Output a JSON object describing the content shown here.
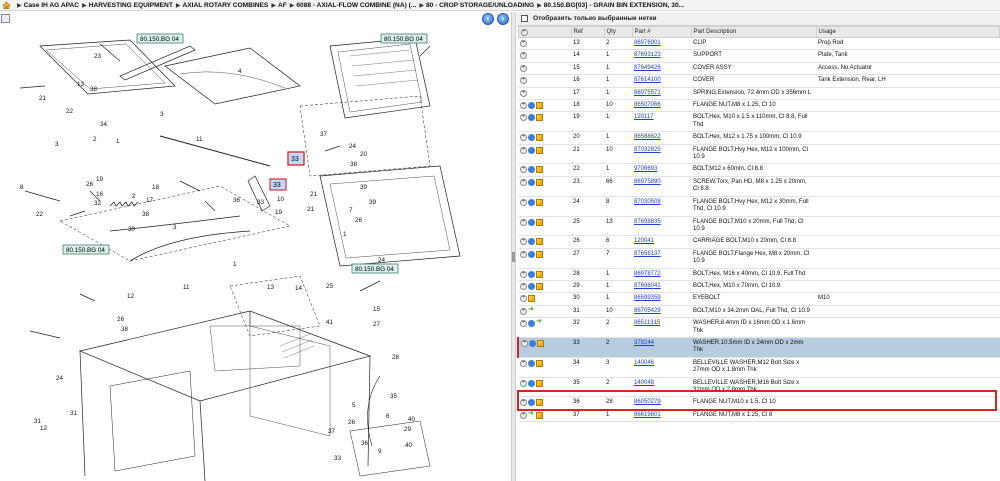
{
  "breadcrumb": {
    "items": [
      "Case IH AG APAC",
      "HARVESTING EQUIPMENT",
      "AXIAL ROTARY COMBINES",
      "AF",
      "6088 - AXIAL-FLOW COMBINE (NA) (...",
      "80 - CROP STORAGE/UNLOADING",
      "80.150.BG[03] - GRAIN BIN EXTENSION, 30..."
    ]
  },
  "filter": {
    "label": "Отобразить только выбранные нетки"
  },
  "diagram": {
    "ref_tags": [
      "80.150.BG 04",
      "80.150.BG 04",
      "80.150.BG 04",
      "80.150.BG 04"
    ],
    "highlighted_callouts": [
      "33",
      "33"
    ],
    "callouts": [
      "23",
      "13",
      "38",
      "4",
      "21",
      "22",
      "1",
      "3",
      "34",
      "2",
      "3",
      "11",
      "37",
      "24",
      "20",
      "38",
      "19",
      "26",
      "16",
      "18",
      "39",
      "2",
      "17",
      "36",
      "38",
      "30",
      "3",
      "32",
      "22",
      "8",
      "19",
      "21",
      "39",
      "1",
      "26",
      "7",
      "10",
      "33",
      "21",
      "24",
      "1",
      "11",
      "12",
      "13",
      "14",
      "31",
      "12",
      "5",
      "25",
      "26",
      "38",
      "41",
      "28",
      "15",
      "27",
      "35",
      "6",
      "40",
      "29",
      "26",
      "9",
      "36",
      "37",
      "33",
      "40",
      "31",
      "24"
    ]
  },
  "table": {
    "columns": [
      "",
      "Ref",
      "Qty",
      "Part #",
      "Part Description",
      "Usage"
    ],
    "rows": [
      {
        "icons": [
          "plus"
        ],
        "ref": "13",
        "qty": "2",
        "part": "86976901",
        "desc": "CLIP",
        "usage": "Prop Rod"
      },
      {
        "icons": [
          "plus"
        ],
        "ref": "14",
        "qty": "1",
        "part": "87693123",
        "desc": "SUPPORT",
        "usage": "Plate, Tank"
      },
      {
        "icons": [
          "plus"
        ],
        "ref": "15",
        "qty": "1",
        "part": "87649426",
        "desc": "COVER ASSY",
        "usage": "Access, No Actuator"
      },
      {
        "icons": [
          "plus"
        ],
        "ref": "16",
        "qty": "1",
        "part": "87614100",
        "desc": "COVER",
        "usage": "Tank Extension, Rear, LH"
      },
      {
        "icons": [
          "plus"
        ],
        "ref": "17",
        "qty": "1",
        "part": "86975571",
        "desc": "SPRING,Extension, 72.4mm OD x 356mm L",
        "usage": ""
      },
      {
        "icons": [
          "plus",
          "info",
          "box"
        ],
        "ref": "18",
        "qty": "10",
        "part": "86507066",
        "desc": "FLANGE NUT,M8 x 1.25, Cl 10",
        "usage": ""
      },
      {
        "icons": [
          "plus",
          "info",
          "box"
        ],
        "ref": "19",
        "qty": "1",
        "part": "120117",
        "desc": "BOLT,Hex, M10 x 1.5 x 110mm, Cl 8.8, Full Thd",
        "usage": ""
      },
      {
        "icons": [
          "plus",
          "info",
          "box"
        ],
        "ref": "20",
        "qty": "1",
        "part": "86588622",
        "desc": "BOLT,Hex, M12 x 1.75 x 100mm, Cl 10.9",
        "usage": ""
      },
      {
        "icons": [
          "plus",
          "info",
          "box"
        ],
        "ref": "21",
        "qty": "10",
        "part": "87032825",
        "desc": "FLANGE BOLT,Hvy Hex, M12 x 100mm, Cl 10.9",
        "usage": ""
      },
      {
        "icons": [
          "plus",
          "info",
          "box"
        ],
        "ref": "22",
        "qty": "1",
        "part": "9706693",
        "desc": "BOLT,M12 x 60mm, Cl 8.8",
        "usage": ""
      },
      {
        "icons": [
          "plus",
          "info",
          "box"
        ],
        "ref": "23",
        "qty": "66",
        "part": "86975890",
        "desc": "SCREW,Torx, Pan HD, M8 x 1.25 x 20mm, Cl 8.8",
        "usage": ""
      },
      {
        "icons": [
          "plus",
          "info",
          "box"
        ],
        "ref": "24",
        "qty": "8",
        "part": "87030508",
        "desc": "FLANGE BOLT,Hvy Hex, M12 x 30mm, Full Thd, Cl 10.9",
        "usage": ""
      },
      {
        "icons": [
          "plus",
          "info",
          "box"
        ],
        "ref": "25",
        "qty": "13",
        "part": "87698835",
        "desc": "FLANGE BOLT,M10 x 20mm, Full Thd, Cl 10.9",
        "usage": ""
      },
      {
        "icons": [
          "plus",
          "info",
          "box"
        ],
        "ref": "26",
        "qty": "6",
        "part": "120041",
        "desc": "CARRIAGE BOLT,M10 x 20mm, Cl 8.8",
        "usage": ""
      },
      {
        "icons": [
          "plus",
          "info",
          "box"
        ],
        "ref": "27",
        "qty": "7",
        "part": "87656137",
        "desc": "FLANGE BOLT,Flange Hex, M8 x 20mm, Cl 10.9",
        "usage": ""
      },
      {
        "icons": [
          "plus",
          "info",
          "box"
        ],
        "ref": "28",
        "qty": "1",
        "part": "86978772",
        "desc": "BOLT,Hex, M16 x 40mm, Cl 10.9, Full Thd",
        "usage": ""
      },
      {
        "icons": [
          "plus",
          "info",
          "box"
        ],
        "ref": "29",
        "qty": "1",
        "part": "87696041",
        "desc": "BOLT,Hex, M10 x 70mm, Cl 10.9",
        "usage": ""
      },
      {
        "icons": [
          "plus",
          "box"
        ],
        "ref": "30",
        "qty": "1",
        "part": "86599359",
        "desc": "EYEBOLT",
        "usage": "M10"
      },
      {
        "icons": [
          "plus",
          "arrow"
        ],
        "ref": "31",
        "qty": "10",
        "part": "86705429",
        "desc": "BOLT,M10 x 34.2mm OAL, Full Thd, Cl 10.9",
        "usage": ""
      },
      {
        "icons": [
          "plus",
          "info",
          "arrow"
        ],
        "ref": "32",
        "qty": "2",
        "part": "86511315",
        "desc": "WASHER,8.4mm ID x 16mm OD x 1.6mm Thk",
        "usage": ""
      },
      {
        "icons": [
          "plus",
          "info",
          "box"
        ],
        "ref": "33",
        "qty": "2",
        "part": "378244",
        "desc": "WASHER,10.5mm ID x 24mm OD x 2mm Thk",
        "usage": "",
        "selected": true
      },
      {
        "icons": [
          "plus",
          "info",
          "box"
        ],
        "ref": "34",
        "qty": "3",
        "part": "140046",
        "desc": "BELLEVILLE WASHER,M12 Bolt Size x 27mm OD x 1.8mm Thk",
        "usage": ""
      },
      {
        "icons": [
          "plus",
          "info",
          "box"
        ],
        "ref": "35",
        "qty": "2",
        "part": "140048",
        "desc": "BELLEVILLE WASHER,M16 Bolt Size x 32mm OD x 2.8mm Thk",
        "usage": ""
      },
      {
        "icons": [
          "plus",
          "info",
          "box"
        ],
        "ref": "36",
        "qty": "28",
        "part": "86050279",
        "desc": "FLANGE NUT,M10 x 1.5, Cl 10",
        "usage": ""
      },
      {
        "icons": [
          "plus",
          "arrow",
          "box"
        ],
        "ref": "37",
        "qty": "1",
        "part": "86619801",
        "desc": "FLANGE NUT,M8 x 1.25, Cl 8",
        "usage": ""
      }
    ]
  }
}
